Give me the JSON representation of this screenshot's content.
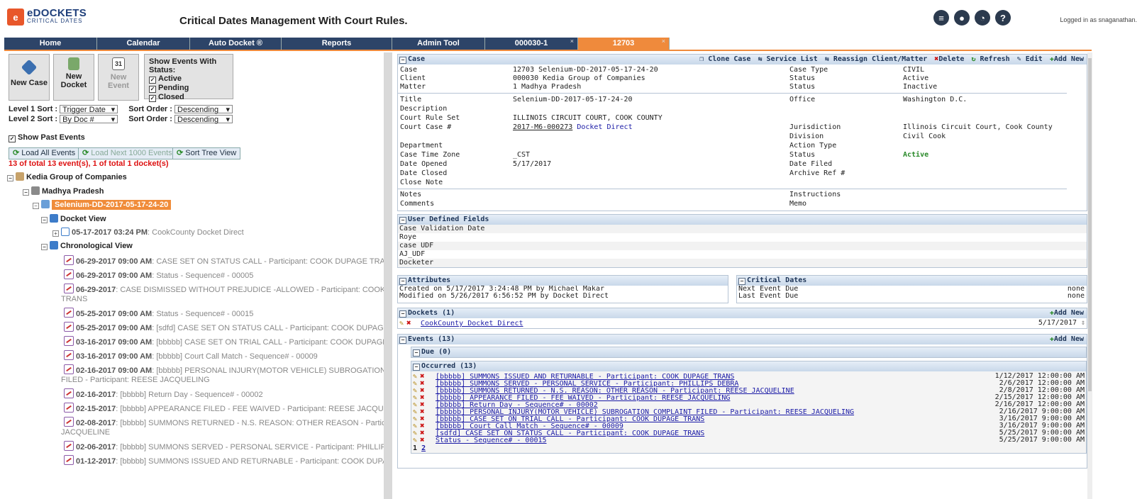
{
  "header": {
    "logo_main": "eDOCKETS",
    "logo_sub": "CRITICAL DATES",
    "logo_badge": "e",
    "app_title": "Critical Dates Management With Court Rules.",
    "logged_in": "Logged in as snaganathan.",
    "icons": [
      "list-icon",
      "user-icon",
      "clock-icon",
      "help-icon"
    ]
  },
  "nav": {
    "tabs": [
      {
        "label": "Home"
      },
      {
        "label": "Calendar"
      },
      {
        "label": "Auto Docket ®"
      },
      {
        "label": "Reports"
      },
      {
        "label": "Admin Tool"
      },
      {
        "label": "000030-1",
        "close": "×"
      },
      {
        "label": "12703",
        "close": "×"
      }
    ]
  },
  "left": {
    "buttons": {
      "new_case": "New Case",
      "new_docket_1": "New",
      "new_docket_2": "Docket",
      "new_event_1": "New",
      "new_event_2": "Event",
      "calendar_day": "31"
    },
    "status_box": {
      "title": "Show Events With Status:",
      "active": "Active",
      "pending": "Pending",
      "closed": "Closed"
    },
    "sort": {
      "level1_label": "Level 1 Sort :",
      "level1_value": "Trigger Date",
      "level2_label": "Level 2 Sort :",
      "level2_value": "By Doc #",
      "order_label": "Sort Order :",
      "order1_value": "Descending",
      "order2_value": "Descending"
    },
    "show_past": "Show Past Events",
    "load_all": "Load All Events",
    "load_next": "Load Next 1000 Events",
    "sort_tree": "Sort Tree View",
    "count_text": "13 of total 13 event(s), 1 of total 1 docket(s)",
    "tree": {
      "client": "Kedia Group of Companies",
      "matter": "Madhya Pradesh",
      "case": "Selenium-DD-2017-05-17-24-20",
      "docket_view": "Docket View",
      "docket_date": "05-17-2017 03:24 PM",
      "docket_name": ": CookCounty Docket Direct",
      "chrono_view": "Chronological View"
    },
    "events": [
      {
        "date": "06-29-2017 09:00 AM",
        "text": ": CASE SET ON STATUS CALL - Participant: COOK DUPAGE TRANS",
        "text2": ""
      },
      {
        "date": "06-29-2017 09:00 AM",
        "text": ": Status - Sequence# - 00005",
        "text2": ""
      },
      {
        "date": "06-29-2017",
        "text": ": CASE DISMISSED WITHOUT PREJUDICE -ALLOWED - Participant: COOK DUPAGE",
        "text2": "TRANS"
      },
      {
        "date": "05-25-2017 09:00 AM",
        "text": ": Status - Sequence# - 00015",
        "text2": ""
      },
      {
        "date": "05-25-2017 09:00 AM",
        "text": ": [sdfd] CASE SET ON STATUS CALL - Participant: COOK DUPAGE TRANS",
        "text2": ""
      },
      {
        "date": "03-16-2017 09:00 AM",
        "text": ": [bbbbb] CASE SET ON TRIAL CALL - Participant: COOK DUPAGE TRANS",
        "text2": ""
      },
      {
        "date": "03-16-2017 09:00 AM",
        "text": ": [bbbbb] Court Call Match - Sequence# - 00009",
        "text2": ""
      },
      {
        "date": "02-16-2017 09:00 AM",
        "text": ": [bbbbb] PERSONAL INJURY(MOTOR VEHICLE) SUBROGATION COMPLAINT",
        "text2": "FILED - Participant: REESE JACQUELING"
      },
      {
        "date": "02-16-2017",
        "text": ": [bbbbb] Return Day - Sequence# - 00002",
        "text2": ""
      },
      {
        "date": "02-15-2017",
        "text": ": [bbbbb] APPEARANCE FILED - FEE WAIVED - Participant: REESE JACQUELING",
        "text2": ""
      },
      {
        "date": "02-08-2017",
        "text": ": [bbbbb] SUMMONS RETURNED - N.S. REASON: OTHER REASON - Participant: REESE",
        "text2": "JACQUELINE"
      },
      {
        "date": "02-06-2017",
        "text": ": [bbbbb] SUMMONS SERVED - PERSONAL SERVICE - Participant: PHILLIPS DEBRA",
        "text2": ""
      },
      {
        "date": "01-12-2017",
        "text": ": [bbbbb] SUMMONS ISSUED AND RETURNABLE - Participant: COOK DUPAGE TRANS",
        "text2": ""
      }
    ]
  },
  "case": {
    "header": "Case",
    "actions": {
      "clone": "Clone Case",
      "service": "Service List",
      "reassign": "Reassign Client/Matter",
      "delete": "Delete",
      "refresh": "Refresh",
      "edit": "Edit",
      "add_new": "Add New"
    },
    "labels": {
      "case": "Case",
      "client": "Client",
      "matter": "Matter",
      "title": "Title",
      "description": "Description",
      "court_rule_set": "Court Rule Set",
      "court_case": "Court Case #",
      "department": "Department",
      "time_zone": "Case Time Zone",
      "date_opened": "Date Opened",
      "date_closed": "Date Closed",
      "close_note": "Close Note",
      "notes": "Notes",
      "comments": "Comments",
      "case_type": "Case Type",
      "status": "Status",
      "office": "Office",
      "jurisdiction": "Jurisdiction",
      "division": "Division",
      "action_type": "Action Type",
      "date_filed": "Date Filed",
      "archive_ref": "Archive Ref #",
      "instructions": "Instructions",
      "memo": "Memo"
    },
    "values": {
      "case": "12703  Selenium-DD-2017-05-17-24-20",
      "client": "000030  Kedia Group of Companies",
      "matter": "1  Madhya Pradesh",
      "title": "Selenium-DD-2017-05-17-24-20",
      "court_rule_set": "ILLINOIS CIRCUIT COURT, COOK COUNTY",
      "court_case": "2017-M6-000273",
      "docket_direct": "Docket Direct",
      "time_zone": "_CST",
      "date_opened": "5/17/2017",
      "case_type": "CIVIL",
      "client_status": "Active",
      "matter_status": "Inactive",
      "office": "Washington D.C.",
      "jurisdiction": "Illinois Circuit Court, Cook County",
      "division": "Civil Cook",
      "case_status": "Active"
    }
  },
  "udf": {
    "header": "User Defined Fields",
    "rows": [
      "Case Validation Date",
      "Roye",
      "case UDF",
      "AJ_UDF",
      "Docketer"
    ]
  },
  "attributes": {
    "header": "Attributes",
    "created": "Created on 5/17/2017 3:24:48 PM by Michael Makar",
    "modified": "Modified on 5/26/2017 6:56:52 PM by Docket Direct"
  },
  "critical": {
    "header": "Critical Dates",
    "next_label": "Next Event Due",
    "next_value": "none",
    "last_label": "Last Event Due",
    "last_value": "none"
  },
  "dockets": {
    "header": "Dockets (1)",
    "add_new": "Add New",
    "name": "CookCounty Docket Direct",
    "date": "5/17/2017"
  },
  "events_panel": {
    "header": "Events (13)",
    "add_new": "Add New",
    "due": "Due (0)",
    "occurred": "Occurred (13)",
    "rows": [
      {
        "text": "[bbbbb] SUMMONS ISSUED AND RETURNABLE - Participant: COOK DUPAGE TRANS",
        "date": "1/12/2017 12:00:00 AM"
      },
      {
        "text": "[bbbbb] SUMMONS SERVED - PERSONAL SERVICE - Participant: PHILLIPS DEBRA",
        "date": "2/6/2017 12:00:00 AM"
      },
      {
        "text": "[bbbbb] SUMMONS RETURNED - N.S. REASON: OTHER REASON - Participant: REESE JACQUELINE",
        "date": "2/8/2017 12:00:00 AM"
      },
      {
        "text": "[bbbbb] APPEARANCE FILED - FEE WAIVED - Participant: REESE JACQUELING",
        "date": "2/15/2017 12:00:00 AM"
      },
      {
        "text": "[bbbbb] Return Day - Sequence# - 00002",
        "date": "2/16/2017 12:00:00 AM"
      },
      {
        "text": "[bbbbb] PERSONAL INJURY(MOTOR VEHICLE) SUBROGATION COMPLAINT FILED - Participant: REESE JACQUELING",
        "date": "2/16/2017 9:00:00 AM"
      },
      {
        "text": "[bbbbb] CASE SET ON TRIAL CALL - Participant: COOK DUPAGE TRANS",
        "date": "3/16/2017 9:00:00 AM"
      },
      {
        "text": "[bbbbb] Court Call Match - Sequence# - 00009",
        "date": "3/16/2017 9:00:00 AM"
      },
      {
        "text": "[sdfd] CASE SET ON STATUS CALL - Participant: COOK DUPAGE TRANS",
        "date": "5/25/2017 9:00:00 AM"
      },
      {
        "text": "Status - Sequence# - 00015",
        "date": "5/25/2017 9:00:00 AM"
      }
    ],
    "page1": "1",
    "page2": "2"
  }
}
